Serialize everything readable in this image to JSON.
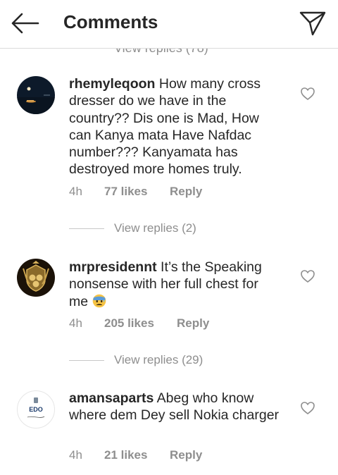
{
  "header": {
    "title": "Comments",
    "back_icon": "arrow-left-icon",
    "send_icon": "paper-plane-icon"
  },
  "cut_off_text": "View replies (78)",
  "comments": [
    {
      "username": "rhemyleqoon",
      "text": " How many cross dresser do we have in the country?? Dis one is Mad, How can Kanya mata Have Nafdac number??? Kanyamata has destroyed more homes truly.",
      "time": "4h",
      "likes": "77 likes",
      "reply": "Reply",
      "view_replies": "View replies (2)"
    },
    {
      "username": "mrpresidennt",
      "text": " It’s the Speaking nonsense with her full chest for me ",
      "emoji": "anxious-face-with-sweat-emoji",
      "time": "4h",
      "likes": "205 likes",
      "reply": "Reply",
      "view_replies": "View replies (29)"
    },
    {
      "username": "amansaparts",
      "text": " Abeg who know where dem Dey sell Nokia charger",
      "time": "4h",
      "likes": "21 likes",
      "reply": "Reply",
      "avatar_logo": "EDO"
    }
  ],
  "colors": {
    "text": "#262626",
    "muted": "#8e8e8e",
    "divider": "#dbdbdb"
  }
}
